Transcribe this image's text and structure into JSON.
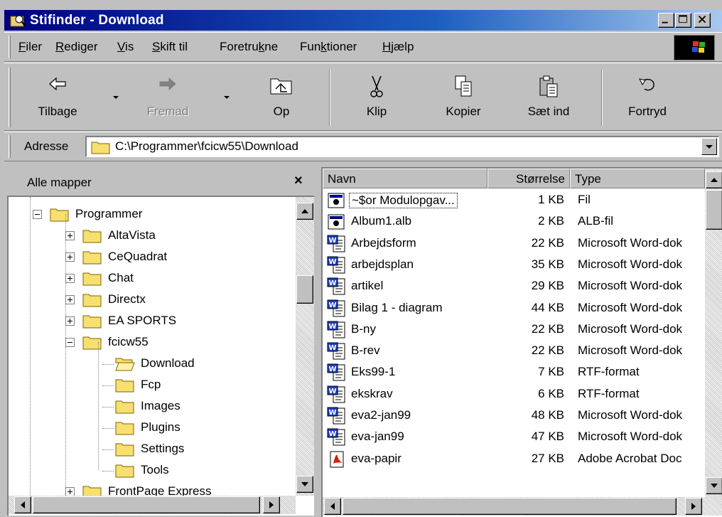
{
  "window": {
    "title": "Stifinder - Download",
    "colors": {
      "titlebar_start": "#000080",
      "titlebar_end": "#a8c8f0",
      "face": "#c0c0c0"
    }
  },
  "menu": {
    "items": [
      {
        "pre": "",
        "accel": "F",
        "post": "iler"
      },
      {
        "pre": "",
        "accel": "R",
        "post": "ediger"
      },
      {
        "pre": "",
        "accel": "V",
        "post": "is"
      },
      {
        "pre": "",
        "accel": "S",
        "post": "kift til"
      },
      {
        "pre": "Foretru",
        "accel": "k",
        "post": "ne"
      },
      {
        "pre": "Fun",
        "accel": "k",
        "post": "tioner"
      },
      {
        "pre": "",
        "accel": "H",
        "post": "jælp"
      }
    ]
  },
  "toolbar": {
    "back_label": "Tilbage",
    "forward_label": "Fremad",
    "up_label": "Op",
    "cut_label": "Klip",
    "copy_label": "Kopier",
    "paste_label": "Sæt ind",
    "undo_label": "Fortryd"
  },
  "address": {
    "label": "Adresse",
    "value": "C:\\Programmer\\fcicw55\\Download"
  },
  "folder_pane": {
    "title": "Alle mapper",
    "close_glyph": "×",
    "tree": [
      {
        "label": "Programmer",
        "level": 0,
        "expander": "minus",
        "open": false
      },
      {
        "label": "AltaVista",
        "level": 1,
        "expander": "plus",
        "open": false
      },
      {
        "label": "CeQuadrat",
        "level": 1,
        "expander": "plus",
        "open": false
      },
      {
        "label": "Chat",
        "level": 1,
        "expander": "plus",
        "open": false
      },
      {
        "label": "Directx",
        "level": 1,
        "expander": "plus",
        "open": false
      },
      {
        "label": "EA SPORTS",
        "level": 1,
        "expander": "plus",
        "open": false
      },
      {
        "label": "fcicw55",
        "level": 1,
        "expander": "minus",
        "open": false
      },
      {
        "label": "Download",
        "level": 2,
        "expander": "none",
        "open": true
      },
      {
        "label": "Fcp",
        "level": 2,
        "expander": "none",
        "open": false
      },
      {
        "label": "Images",
        "level": 2,
        "expander": "none",
        "open": false
      },
      {
        "label": "Plugins",
        "level": 2,
        "expander": "none",
        "open": false
      },
      {
        "label": "Settings",
        "level": 2,
        "expander": "none",
        "open": false
      },
      {
        "label": "Tools",
        "level": 2,
        "expander": "none",
        "open": false
      },
      {
        "label": "FrontPage Express",
        "level": 1,
        "expander": "plus",
        "open": false
      }
    ]
  },
  "file_list": {
    "columns": [
      "Navn",
      "Størrelse",
      "Type"
    ],
    "rows": [
      {
        "name": "~$or Modulopgav...",
        "size": "1 KB",
        "type": "Fil",
        "icon": "generic-file-icon"
      },
      {
        "name": "Album1.alb",
        "size": "2 KB",
        "type": "ALB-fil",
        "icon": "generic-file-icon"
      },
      {
        "name": "Arbejdsform",
        "size": "22 KB",
        "type": "Microsoft Word-dok",
        "icon": "word-document-icon"
      },
      {
        "name": "arbejdsplan",
        "size": "35 KB",
        "type": "Microsoft Word-dok",
        "icon": "word-document-icon"
      },
      {
        "name": "artikel",
        "size": "29 KB",
        "type": "Microsoft Word-dok",
        "icon": "word-document-icon"
      },
      {
        "name": "Bilag 1 - diagram",
        "size": "44 KB",
        "type": "Microsoft Word-dok",
        "icon": "word-document-icon"
      },
      {
        "name": "B-ny",
        "size": "22 KB",
        "type": "Microsoft Word-dok",
        "icon": "word-document-icon"
      },
      {
        "name": "B-rev",
        "size": "22 KB",
        "type": "Microsoft Word-dok",
        "icon": "word-document-icon"
      },
      {
        "name": "Eks99-1",
        "size": "7 KB",
        "type": "RTF-format",
        "icon": "word-document-icon"
      },
      {
        "name": "ekskrav",
        "size": "6 KB",
        "type": "RTF-format",
        "icon": "word-document-icon"
      },
      {
        "name": "eva2-jan99",
        "size": "48 KB",
        "type": "Microsoft Word-dok",
        "icon": "word-document-icon"
      },
      {
        "name": "eva-jan99",
        "size": "47 KB",
        "type": "Microsoft Word-dok",
        "icon": "word-document-icon"
      },
      {
        "name": "eva-papir",
        "size": "27 KB",
        "type": "Adobe Acrobat Doc",
        "icon": "acrobat-document-icon"
      }
    ]
  }
}
